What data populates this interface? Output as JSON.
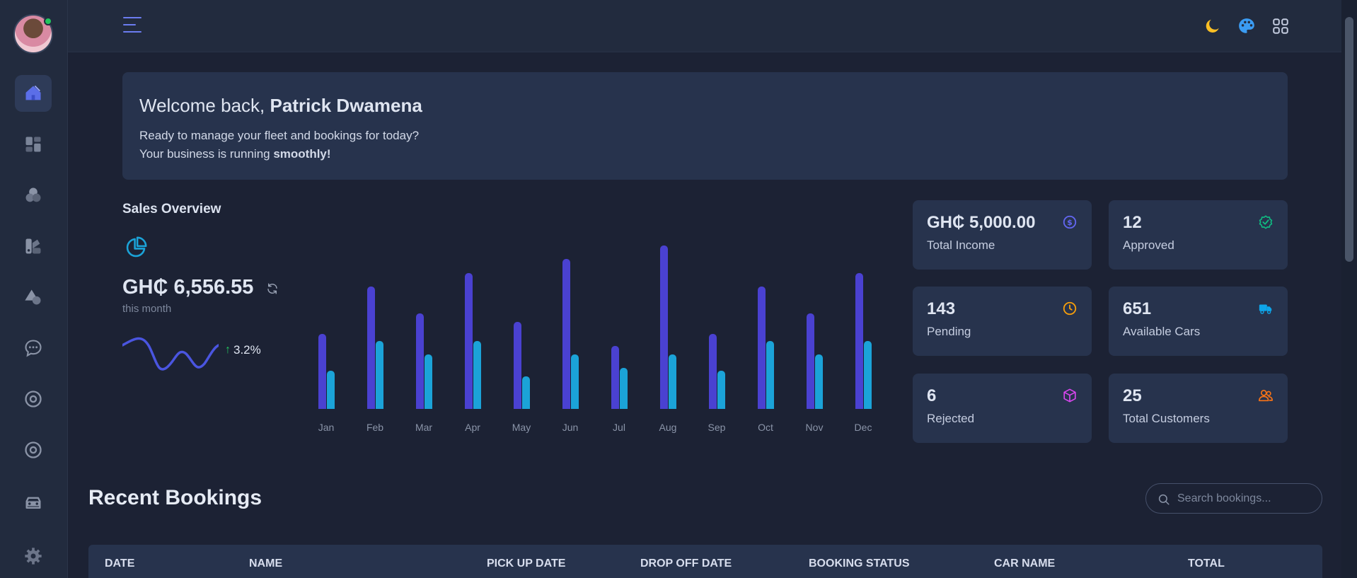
{
  "header": {
    "menu_icon": "hamburger-icon",
    "actions": [
      "moon-icon",
      "palette-icon",
      "grid-apps-icon"
    ]
  },
  "sidebar": {
    "items": [
      {
        "icon": "home-icon",
        "active": true
      },
      {
        "icon": "dashboard-icon"
      },
      {
        "icon": "circles-icon"
      },
      {
        "icon": "swatch-icon"
      },
      {
        "icon": "shapes-icon"
      },
      {
        "icon": "chat-icon"
      },
      {
        "icon": "target-icon"
      },
      {
        "icon": "target-icon"
      },
      {
        "icon": "car-icon"
      },
      {
        "icon": "settings-icon"
      }
    ]
  },
  "welcome": {
    "greeting": "Welcome back, ",
    "name": "Patrick Dwamena",
    "line1": "Ready to manage your fleet and bookings for today?",
    "line2_prefix": "Your business is running ",
    "line2_bold": "smoothly!"
  },
  "sales": {
    "title": "Sales Overview",
    "amount": "GH₵ 6,556.55",
    "period": "this month",
    "trend": "3.2%"
  },
  "chart_data": {
    "type": "bar",
    "categories": [
      "Jan",
      "Feb",
      "Mar",
      "Apr",
      "May",
      "Jun",
      "Jul",
      "Aug",
      "Sep",
      "Oct",
      "Nov",
      "Dec"
    ],
    "series": [
      {
        "values": [
          55,
          90,
          70,
          100,
          64,
          110,
          46,
          120,
          55,
          90,
          70,
          100
        ]
      },
      {
        "values": [
          28,
          50,
          40,
          50,
          24,
          40,
          30,
          40,
          28,
          50,
          40,
          50
        ]
      }
    ],
    "ylim": [
      0,
      120
    ],
    "colors": [
      "#4a41d1",
      "#1ba3d8"
    ]
  },
  "stats": [
    {
      "value": "GH₵ 5,000.00",
      "label": "Total Income",
      "icon": "dollar-icon",
      "color": "#6366f1"
    },
    {
      "value": "12",
      "label": "Approved",
      "icon": "check-badge-icon",
      "color": "#10b981"
    },
    {
      "value": "143",
      "label": "Pending",
      "icon": "clock-icon",
      "color": "#f59e0b"
    },
    {
      "value": "651",
      "label": "Available Cars",
      "icon": "truck-icon",
      "color": "#0ea5e9"
    },
    {
      "value": "6",
      "label": "Rejected",
      "icon": "cube-icon",
      "color": "#d946ef"
    },
    {
      "value": "25",
      "label": "Total Customers",
      "icon": "users-icon",
      "color": "#f97316"
    }
  ],
  "bookings": {
    "title": "Recent Bookings",
    "search_placeholder": "Search bookings...",
    "columns": [
      "DATE",
      "NAME",
      "PICK UP DATE",
      "DROP OFF DATE",
      "BOOKING STATUS",
      "CAR NAME",
      "TOTAL"
    ]
  }
}
